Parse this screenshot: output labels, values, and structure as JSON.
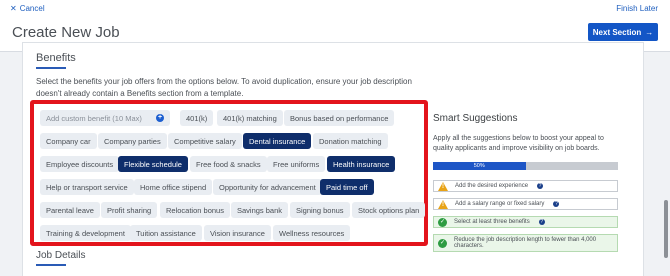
{
  "header": {
    "cancel_label": "Cancel",
    "finish_label": "Finish Later",
    "title": "Create New Job",
    "next_label": "Next Section"
  },
  "benefits": {
    "title": "Benefits",
    "description": "Select the benefits your job offers from the options below. To avoid duplication, ensure your job description doesn't already contain a Benefits section from a template.",
    "custom_placeholder": "Add custom benefit (10 Max)",
    "chips": [
      {
        "label": "401(k)",
        "selected": false
      },
      {
        "label": "401(k) matching",
        "selected": false
      },
      {
        "label": "Bonus based on performance",
        "selected": false
      },
      {
        "label": "Company car",
        "selected": false
      },
      {
        "label": "Company parties",
        "selected": false
      },
      {
        "label": "Competitive salary",
        "selected": false
      },
      {
        "label": "Dental insurance",
        "selected": true
      },
      {
        "label": "Donation matching",
        "selected": false
      },
      {
        "label": "Employee discounts",
        "selected": false
      },
      {
        "label": "Flexible schedule",
        "selected": true
      },
      {
        "label": "Free food & snacks",
        "selected": false
      },
      {
        "label": "Free uniforms",
        "selected": false
      },
      {
        "label": "Health insurance",
        "selected": true
      },
      {
        "label": "Help or transport service",
        "selected": false
      },
      {
        "label": "Home office stipend",
        "selected": false
      },
      {
        "label": "Opportunity for advancement",
        "selected": false
      },
      {
        "label": "Paid time off",
        "selected": true
      },
      {
        "label": "Parental leave",
        "selected": false
      },
      {
        "label": "Profit sharing",
        "selected": false
      },
      {
        "label": "Relocation bonus",
        "selected": false
      },
      {
        "label": "Savings bank",
        "selected": false
      },
      {
        "label": "Signing bonus",
        "selected": false
      },
      {
        "label": "Stock options plan",
        "selected": false
      },
      {
        "label": "Training & development",
        "selected": false
      },
      {
        "label": "Tuition assistance",
        "selected": false
      },
      {
        "label": "Vision insurance",
        "selected": false
      },
      {
        "label": "Wellness resources",
        "selected": false
      }
    ]
  },
  "smart_suggestions": {
    "title": "Smart Suggestions",
    "description": "Apply all the suggestions below to boost your appeal to quality applicants and improve visibility on job boards.",
    "progress": 0.5,
    "progress_label": "50%",
    "items": [
      {
        "text": "Add the desired experience",
        "status": "warning"
      },
      {
        "text": "Add a salary range or fixed salary",
        "status": "warning"
      },
      {
        "text": "Select at least three benefits",
        "status": "done"
      },
      {
        "text": "Reduce the job description length to fewer than 4,000 characters.",
        "status": "done"
      }
    ]
  },
  "job_details": {
    "title": "Job Details"
  },
  "colors": {
    "accent": "#1356c6",
    "selected_chip": "#0f2e6b",
    "highlight_border": "#e3141c",
    "success": "#2e9c42",
    "warning": "#e8a317"
  }
}
